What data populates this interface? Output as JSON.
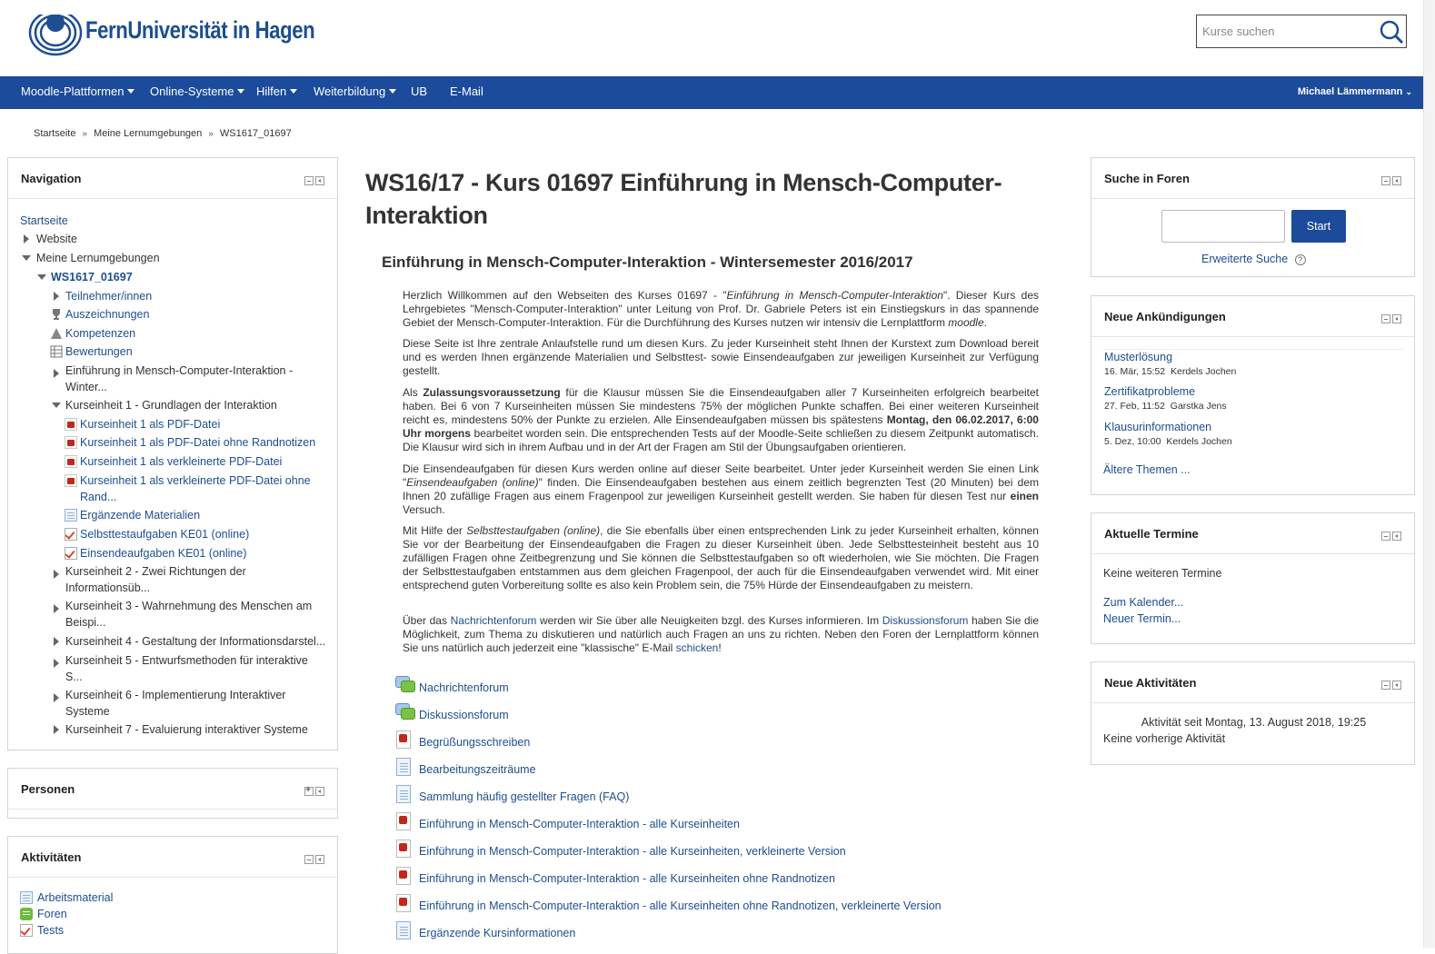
{
  "header": {
    "logo_text": "FernUniversität in Hagen",
    "search_placeholder": "Kurse suchen"
  },
  "nav": {
    "items": [
      "Moodle-Plattformen",
      "Online-Systeme",
      "Hilfen",
      "Weiterbildung",
      "UB",
      "E-Mail"
    ],
    "user": "Michael Lämmermann"
  },
  "breadcrumb": [
    "Startseite",
    "Meine Lernumgebungen",
    "WS1617_01697"
  ],
  "navigation": {
    "title": "Navigation",
    "items": {
      "home": "Startseite",
      "website": "Website",
      "my": "Meine Lernumgebungen",
      "course": "WS1617_01697",
      "participants": "Teilnehmer/innen",
      "badges": "Auszeichnungen",
      "competencies": "Kompetenzen",
      "grades": "Bewertungen",
      "intro": "Einführung in Mensch-Computer-Interaktion -",
      "intro2": "Winter...",
      "ke1": "Kurseinheit 1 - Grundlagen der Interaktion",
      "ke1a": "Kurseinheit 1 als PDF-Datei",
      "ke1b": "Kurseinheit 1 als PDF-Datei ohne Randnotizen",
      "ke1c": "Kurseinheit 1 als verkleinerte PDF-Datei",
      "ke1d": "Kurseinheit 1 als verkleinerte PDF-Datei ohne",
      "ke1d2": "Rand...",
      "ke1e": "Ergänzende Materialien",
      "ke1f": "Selbsttestaufgaben KE01 (online)",
      "ke1g": "Einsendeaufgaben KE01 (online)",
      "ke2": "Kurseinheit 2 - Zwei Richtungen der",
      "ke2b": "Informationsüb...",
      "ke3": "Kurseinheit 3 - Wahrnehmung des Menschen am",
      "ke3b": "Beispi...",
      "ke4": "Kurseinheit 4 - Gestaltung der Informationsdarstel...",
      "ke5": "Kurseinheit 5 - Entwurfsmethoden für interaktive",
      "ke5b": "S...",
      "ke6": "Kurseinheit 6 - Implementierung Interaktiver",
      "ke6b": "Systeme",
      "ke7": "Kurseinheit 7 - Evaluierung interaktiver Systeme"
    }
  },
  "persons": {
    "title": "Personen"
  },
  "activities": {
    "title": "Aktivitäten",
    "items": [
      "Arbeitsmaterial",
      "Foren",
      "Tests"
    ]
  },
  "main": {
    "title": "WS16/17 - Kurs 01697 Einführung in Mensch-Computer-Interaktion",
    "section_title": "Einführung in Mensch-Computer-Interaktion - Wintersemester 2016/2017",
    "p1": {
      "a": "Herzlich Willkommen auf den Webseiten des Kurses 01697 - \"",
      "b": "Einführung in Mensch-Computer-Interaktion",
      "c": "\". Dieser Kurs des Lehrgebietes \"Mensch-Computer-Interaktion\" unter Leitung von Prof. Dr. Gabriele Peters ist ein Einstiegskurs in das spannende Gebiet der Mensch-Computer-Interaktion. Für die Durchführung des Kurses nutzen wir intensiv die Lernplattform ",
      "d": "moodle",
      "e": "."
    },
    "p2": "Diese Seite ist Ihre zentrale Anlaufstelle rund um diesen Kurs. Zu jeder Kurseinheit steht Ihnen der Kurstext zum Download bereit und es werden Ihnen ergänzende Materialien und Selbsttest- sowie Einsendeaufgaben zur jeweiligen Kurseinheit zur Verfügung gestellt.",
    "p3": {
      "a": "Als ",
      "b": "Zulassungsvoraussetzung",
      "c": " für die Klausur müssen Sie die Einsendeaufgaben aller 7 Kurseinheiten erfolgreich bearbeitet haben. Bei 6 von 7 Kurseinheiten müssen Sie mindestens 75% der möglichen Punkte schaffen. Bei einer weiteren Kurseinheit reicht es, mindestens 50% der Punkte zu erzielen. Alle Einsendeaufgaben müssen bis spätestens ",
      "d": "Montag, den 06.02.2017, 6:00 Uhr morgens",
      "e": " bearbeitet worden sein. Die entsprechenden Tests auf der Moodle-Seite schließen zu diesem Zeitpunkt automatisch. Die Klausur wird sich in ihrem Aufbau und in der Art der Fragen am Stil der Übungsaufgaben orientieren."
    },
    "p4": {
      "a": "Die Einsendeaufgaben für diesen Kurs werden online auf dieser Seite bearbeitet. Unter jeder Kurseinheit werden Sie einen Link \"",
      "b": "Einsendeaufgaben (online)",
      "c": "\" finden. Die Einsendeaufgaben bestehen aus einem zeitlich begrenzten Test (20 Minuten) bei dem Ihnen 20 zufällige Fragen aus einem Fragenpool zur jeweiligen Kurseinheit gestellt werden. Sie haben für diesen Test nur ",
      "d": "einen",
      "e": " Versuch."
    },
    "p5": {
      "a": "Mit Hilfe der ",
      "b": "Selbsttestaufgaben (online)",
      "c": ", die Sie ebenfalls über einen entsprechenden Link zu jeder Kurseinheit erhalten, können Sie vor der Bearbeitung der Einsendeaufgaben die Fragen zu dieser Kurseinheit üben. Jede Selbsttesteinheit besteht aus 10 zufälligen Fragen ohne Zeitbegrenzung und Sie können die Selbsttestaufgaben so oft wiederholen, wie Sie möchten. Die Fragen der Selbsttestaufgaben entstammen aus dem gleichen Fragenpool, der auch für die Einsendeaufgaben verwendet wird. Mit einer entsprechend guten Vorbereitung sollte es also kein Problem sein, die 75% Hürde der Einsendeaufgaben zu meistern."
    },
    "p6": {
      "a": "Über das ",
      "b": "Nachrichtenforum",
      "c": " werden wir Sie über alle Neuigkeiten bzgl. des Kurses informieren. Im ",
      "d": "Diskussionsforum",
      "e": " haben Sie die Möglichkeit, zum Thema zu diskutieren und natürlich auch Fragen an uns zu richten. Neben den Foren der Lernplattform können Sie uns natürlich auch jederzeit eine \"klassische\" E-Mail ",
      "f": "schicken",
      "g": "!"
    },
    "resources": [
      "Nachrichtenforum",
      "Diskussionsforum",
      "Begrüßungsschreiben",
      "Bearbeitungszeiträume",
      "Sammlung häufig gestellter Fragen (FAQ)",
      "Einführung in Mensch-Computer-Interaktion - alle Kurseinheiten",
      "Einführung in Mensch-Computer-Interaktion - alle Kurseinheiten, verkleinerte Version",
      "Einführung in Mensch-Computer-Interaktion - alle Kurseinheiten ohne Randnotizen",
      "Einführung in Mensch-Computer-Interaktion - alle Kurseinheiten ohne Randnotizen, verkleinerte Version",
      "Ergänzende Kursinformationen"
    ]
  },
  "forum_search": {
    "title": "Suche in Foren",
    "button": "Start",
    "advanced": "Erweiterte Suche"
  },
  "news": {
    "title": "Neue Ankündigungen",
    "items": [
      {
        "title": "Musterlösung",
        "date": "16. Mär, 15:52",
        "author": "Kerdels Jochen"
      },
      {
        "title": "Zertifikatprobleme",
        "date": "27. Feb, 11:52",
        "author": "Garstka Jens"
      },
      {
        "title": "Klausurinformationen",
        "date": "5. Dez, 10:00",
        "author": "Kerdels Jochen"
      }
    ],
    "more": "Ältere Themen ..."
  },
  "events": {
    "title": "Aktuelle Termine",
    "none": "Keine weiteren Termine",
    "calendar": "Zum Kalender...",
    "new": "Neuer Termin..."
  },
  "recent": {
    "title": "Neue Aktivitäten",
    "since": "Aktivität seit Montag, 13. August 2018, 19:25",
    "none": "Keine vorherige Aktivität"
  }
}
